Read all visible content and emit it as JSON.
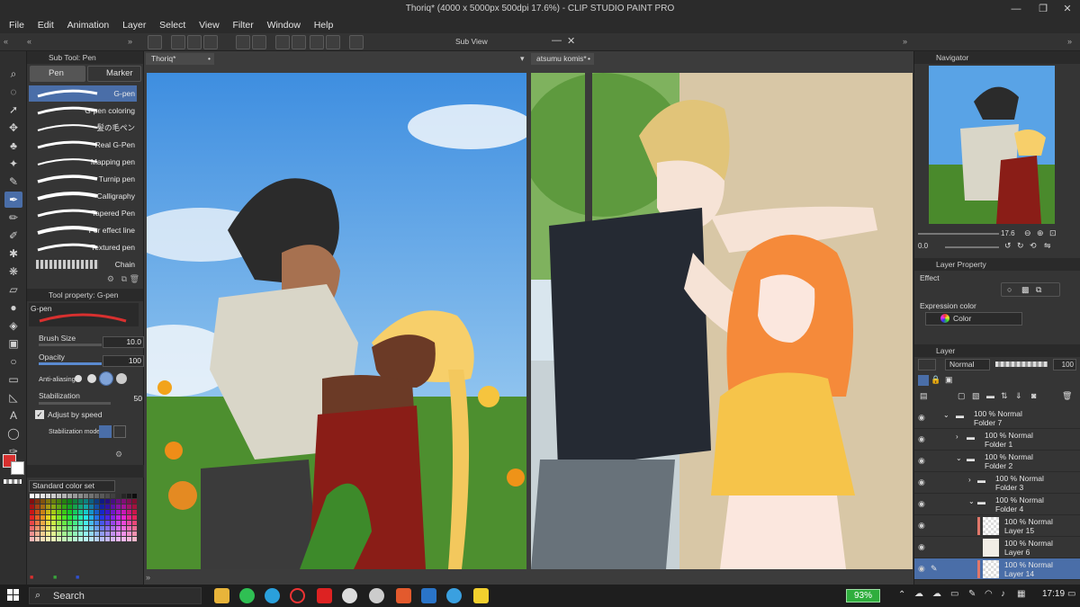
{
  "window": {
    "title": "Thoriq* (4000 x 5000px 500dpi 17.6%)  - CLIP STUDIO PAINT PRO"
  },
  "menu": [
    "File",
    "Edit",
    "Animation",
    "Layer",
    "Select",
    "View",
    "Filter",
    "Window",
    "Help"
  ],
  "subview_label": "Sub View",
  "subtool": {
    "header": "Sub Tool: Pen",
    "tabs": [
      "Pen",
      "Marker"
    ],
    "brushes": [
      "G-pen",
      "G-pen coloring",
      "髪の毛ペン",
      "Real G-Pen",
      "Mapping pen",
      "Turnip pen",
      "Calligraphy",
      "Tapered Pen",
      "For effect line",
      "Textured pen",
      "Chain"
    ],
    "selected_brush": "G-pen"
  },
  "tool_property": {
    "header": "Tool property: G-pen",
    "preset_name": "G-pen",
    "brush_size_label": "Brush Size",
    "brush_size": "10.0",
    "opacity_label": "Opacity",
    "opacity": "100",
    "antialiasing_label": "Anti-aliasing",
    "stabilization_label": "Stabilization",
    "stabilization": "50",
    "adjust_speed_label": "Adjust by speed",
    "stab_mode_label": "Stabilization mode"
  },
  "colorset": {
    "label": "Standard color set"
  },
  "documents": {
    "left_tab": "Thoriq*",
    "right_tab": "atsumu komis*"
  },
  "navigator": {
    "header": "Navigator",
    "zoom": "17.6",
    "rotation": "0.0"
  },
  "layer_property": {
    "header": "Layer Property",
    "effect_label": "Effect",
    "expression_label": "Expression color",
    "expression_value": "Color"
  },
  "layers": {
    "header": "Layer",
    "blend_mode": "Normal",
    "opacity": "100",
    "items": [
      {
        "line1": "100 % Normal",
        "line2": "Folder 7",
        "indent": 0,
        "folder": true
      },
      {
        "line1": "100 % Normal",
        "line2": "Folder 1",
        "indent": 1,
        "folder": true
      },
      {
        "line1": "100 % Normal",
        "line2": "Folder 2",
        "indent": 1,
        "folder": true
      },
      {
        "line1": "100 % Normal",
        "line2": "Folder 3",
        "indent": 2,
        "folder": true
      },
      {
        "line1": "100 % Normal",
        "line2": "Folder 4",
        "indent": 2,
        "folder": true
      },
      {
        "line1": "100 % Normal",
        "line2": "Layer 15",
        "indent": 3,
        "folder": false
      },
      {
        "line1": "100 % Normal",
        "line2": "Layer 6",
        "indent": 3,
        "folder": false
      },
      {
        "line1": "100 % Normal",
        "line2": "Layer 14",
        "indent": 3,
        "folder": false
      }
    ]
  },
  "taskbar": {
    "search": "Search",
    "battery": "93%",
    "time": "17:19"
  },
  "colors": {
    "accent": "#4a6ea8",
    "main_color": "#d8302f",
    "battery": "#2fae3d"
  }
}
